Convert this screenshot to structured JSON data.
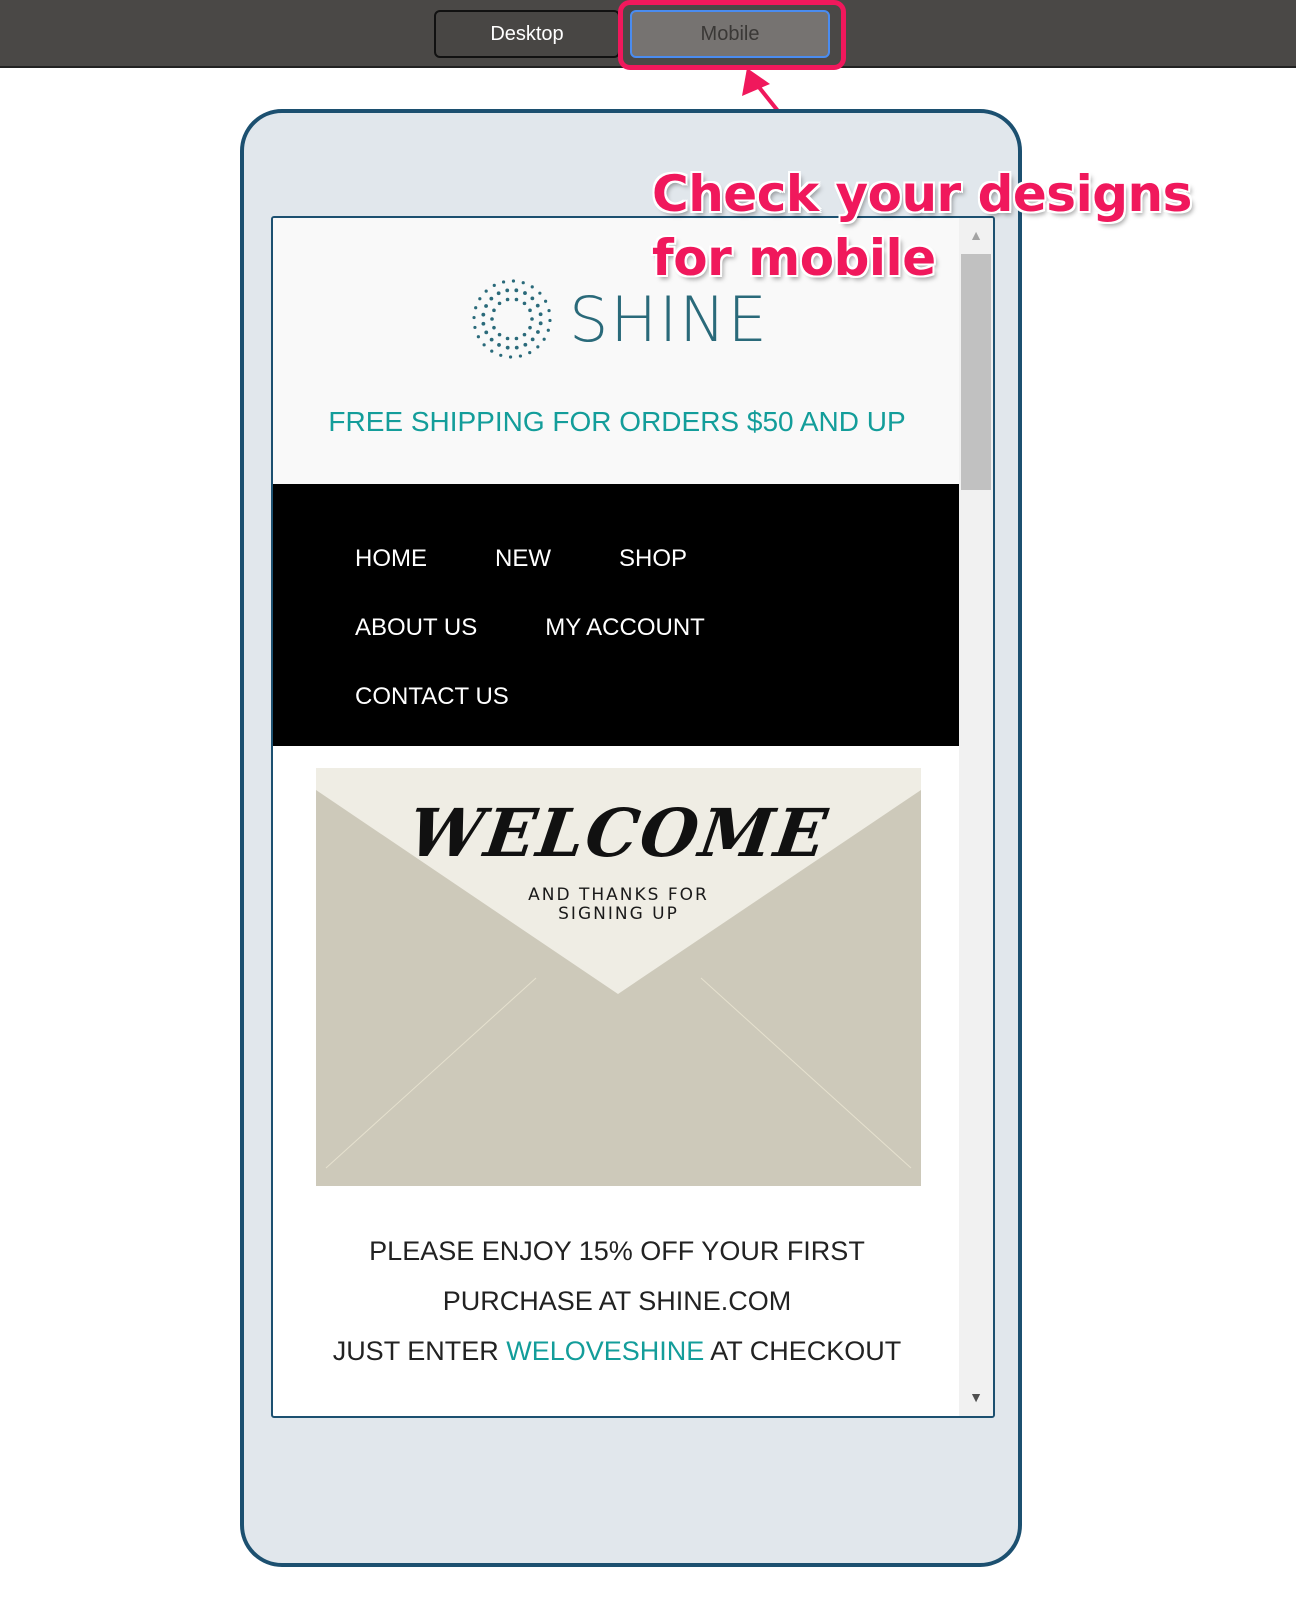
{
  "toolbar": {
    "desktop_label": "Desktop",
    "mobile_label": "Mobile",
    "active_view": "Mobile"
  },
  "annotation": {
    "text": "Check your designs\nfor mobile",
    "color": "#f0185c"
  },
  "email": {
    "logo_text": "SHINE",
    "logo_icon": "sunburst-dots-icon",
    "shipping_banner": "FREE SHIPPING FOR ORDERS $50 AND UP",
    "nav": {
      "rows": [
        [
          "HOME",
          "NEW",
          "SHOP"
        ],
        [
          "ABOUT US",
          "MY ACCOUNT"
        ],
        [
          "CONTACT US"
        ]
      ]
    },
    "hero": {
      "headline": "WELCOME",
      "subline_1": "AND THANKS FOR",
      "subline_2": "SIGNING UP"
    },
    "promo": {
      "line1": "PLEASE ENJOY 15% OFF YOUR FIRST",
      "line2": "PURCHASE AT SHINE.COM",
      "line3_prefix": "JUST ENTER ",
      "code": "WELOVESHINE",
      "line3_suffix": " AT CHECKOUT"
    },
    "accent_color": "#139d9a",
    "logo_color": "#2a6a7a"
  },
  "scrollbar": {
    "up_icon": "▲",
    "down_icon": "▼"
  }
}
